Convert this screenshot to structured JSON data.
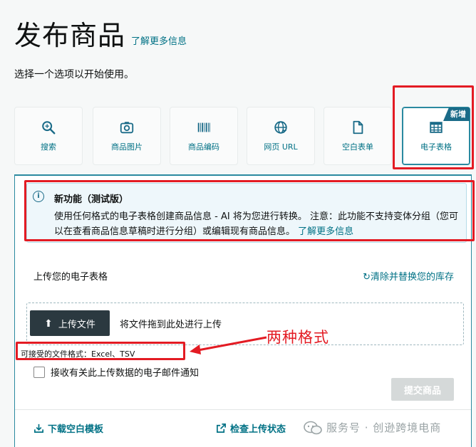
{
  "header": {
    "title": "发布商品",
    "learn_more": "了解更多信息",
    "subtitle": "选择一个选项以开始使用。"
  },
  "options": [
    {
      "label": "搜索",
      "icon": "search-icon"
    },
    {
      "label": "商品图片",
      "icon": "camera-icon"
    },
    {
      "label": "商品编码",
      "icon": "barcode-icon"
    },
    {
      "label": "网页 URL",
      "icon": "globe-icon"
    },
    {
      "label": "空白表单",
      "icon": "document-icon"
    },
    {
      "label": "电子表格",
      "icon": "spreadsheet-icon",
      "badge": "新增",
      "selected": true
    }
  ],
  "info": {
    "title": "新功能（测试版）",
    "body": "使用任何格式的电子表格创建商品信息 - AI 将为您进行转换。 注意：此功能不支持变体分组（您可以在查看商品信息草稿时进行分组）或编辑现有商品信息。",
    "link": "了解更多信息"
  },
  "upload": {
    "section_label": "上传您的电子表格",
    "clear_link": "清除并替换您的库存",
    "button_label": "上传文件",
    "drop_hint": "将文件拖到此处进行上传",
    "formats": "可接受的文件格式：Excel、TSV",
    "email_notify_label": "接收有关此上传数据的电子邮件通知",
    "email_notify_checked": false,
    "submit_label": "提交商品"
  },
  "annotation": {
    "text": "两种格式"
  },
  "footer": {
    "download_template": "下载空白模板",
    "check_status": "检查上传状态"
  },
  "watermark": {
    "text": "服务号 · 创逊跨境电商"
  },
  "colors": {
    "accent": "#007185",
    "highlight_red": "#e31b23",
    "badge": "#1a6b88",
    "upload_button": "#2b3940"
  }
}
